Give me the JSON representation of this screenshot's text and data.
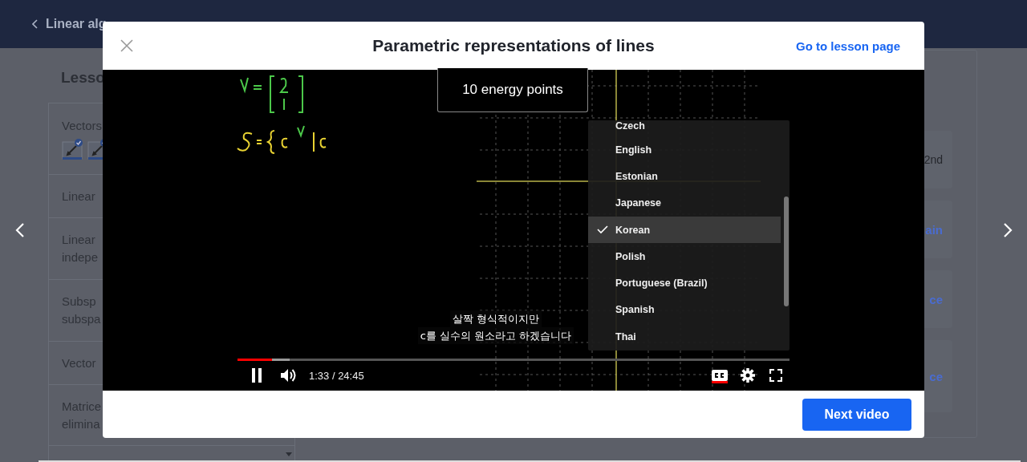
{
  "page": {
    "back_link": "Linear alg",
    "lessons_heading": "Lesso",
    "lessons": [
      {
        "lines": [
          "Vectors"
        ],
        "badges": [
          {
            "checked": true
          },
          {
            "checked": true
          }
        ]
      },
      {
        "lines": [
          "Linear"
        ]
      },
      {
        "lines": [
          "Linear",
          "indepe"
        ]
      },
      {
        "lines": [
          "Subsp",
          "subspa"
        ]
      },
      {
        "lines": [
          "Vector"
        ]
      },
      {
        "lines": [
          "Matrice",
          "elimina"
        ]
      }
    ],
    "cards": [
      {
        "text": "2nd",
        "kind": "plain"
      },
      {
        "text": "ain",
        "kind": "link"
      },
      {
        "text": "ce",
        "kind": "link"
      },
      {
        "text": "ce",
        "kind": "link"
      }
    ]
  },
  "modal": {
    "title": "Parametric representations of lines",
    "lesson_link": "Go to lesson page",
    "video": {
      "toast": "10 energy points",
      "captions": [
        "살짝 형식적이지만",
        "c를 실수의 원소라고 하겠습니다"
      ],
      "languages": [
        {
          "label": "Czech",
          "selected": false
        },
        {
          "label": "English",
          "selected": false
        },
        {
          "label": "Estonian",
          "selected": false
        },
        {
          "label": "Japanese",
          "selected": false
        },
        {
          "label": "Korean",
          "selected": true
        },
        {
          "label": "Polish",
          "selected": false
        },
        {
          "label": "Portuguese (Brazil)",
          "selected": false
        },
        {
          "label": "Spanish",
          "selected": false
        },
        {
          "label": "Thai",
          "selected": false
        }
      ],
      "progress": {
        "level": 0.063,
        "buffered": {
          "level": 0.095
        }
      },
      "playing": true,
      "time": "1:33 / 24:45",
      "captions_on": true
    },
    "next_button": "Next video"
  }
}
